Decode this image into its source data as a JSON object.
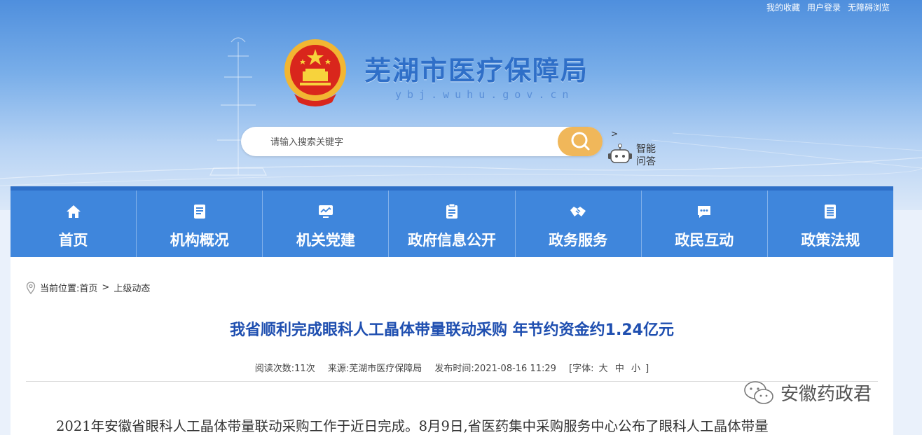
{
  "header": {
    "top_links": [
      "我的收藏",
      "用户登录",
      "无障碍浏览"
    ],
    "site_title": "芜湖市医疗保障局",
    "site_domain": "ybj.wuhu.gov.cn"
  },
  "search": {
    "placeholder": "请输入搜索关键字",
    "smart_qa_arrow": ">",
    "smart_qa_label": "智能问答"
  },
  "nav": {
    "items": [
      {
        "label": "首页",
        "icon": "home-icon"
      },
      {
        "label": "机构概况",
        "icon": "document-icon"
      },
      {
        "label": "机关党建",
        "icon": "monitor-icon"
      },
      {
        "label": "政府信息公开",
        "icon": "clipboard-icon"
      },
      {
        "label": "政务服务",
        "icon": "handshake-icon"
      },
      {
        "label": "政民互动",
        "icon": "chat-icon"
      },
      {
        "label": "政策法规",
        "icon": "list-icon"
      }
    ]
  },
  "breadcrumb": {
    "prefix": "当前位置:",
    "home": "首页",
    "separator": ">",
    "current": "上级动态"
  },
  "article": {
    "title": "我省顺利完成眼科人工晶体带量联动采购 年节约资金约1.24亿元",
    "views": "阅读次数:11次",
    "source": "来源:芜湖市医疗保障局",
    "published": "发布时间:2021-08-16 11:29",
    "font_size_label": "[字体:",
    "font_sizes": [
      "大",
      "中",
      "小"
    ],
    "font_size_close": "]",
    "first_paragraph": "2021年安徽省眼科人工晶体带量联动采购工作于近日完成。8月9日,省医药集中采购服务中心公布了眼科人工晶体带量"
  },
  "watermark": {
    "text": "安徽药政君"
  },
  "colors": {
    "nav_bg": "#3f86dc",
    "title_blue": "#1f4fb0",
    "search_button": "#f0b75a",
    "site_title": "#2f6fc8"
  }
}
